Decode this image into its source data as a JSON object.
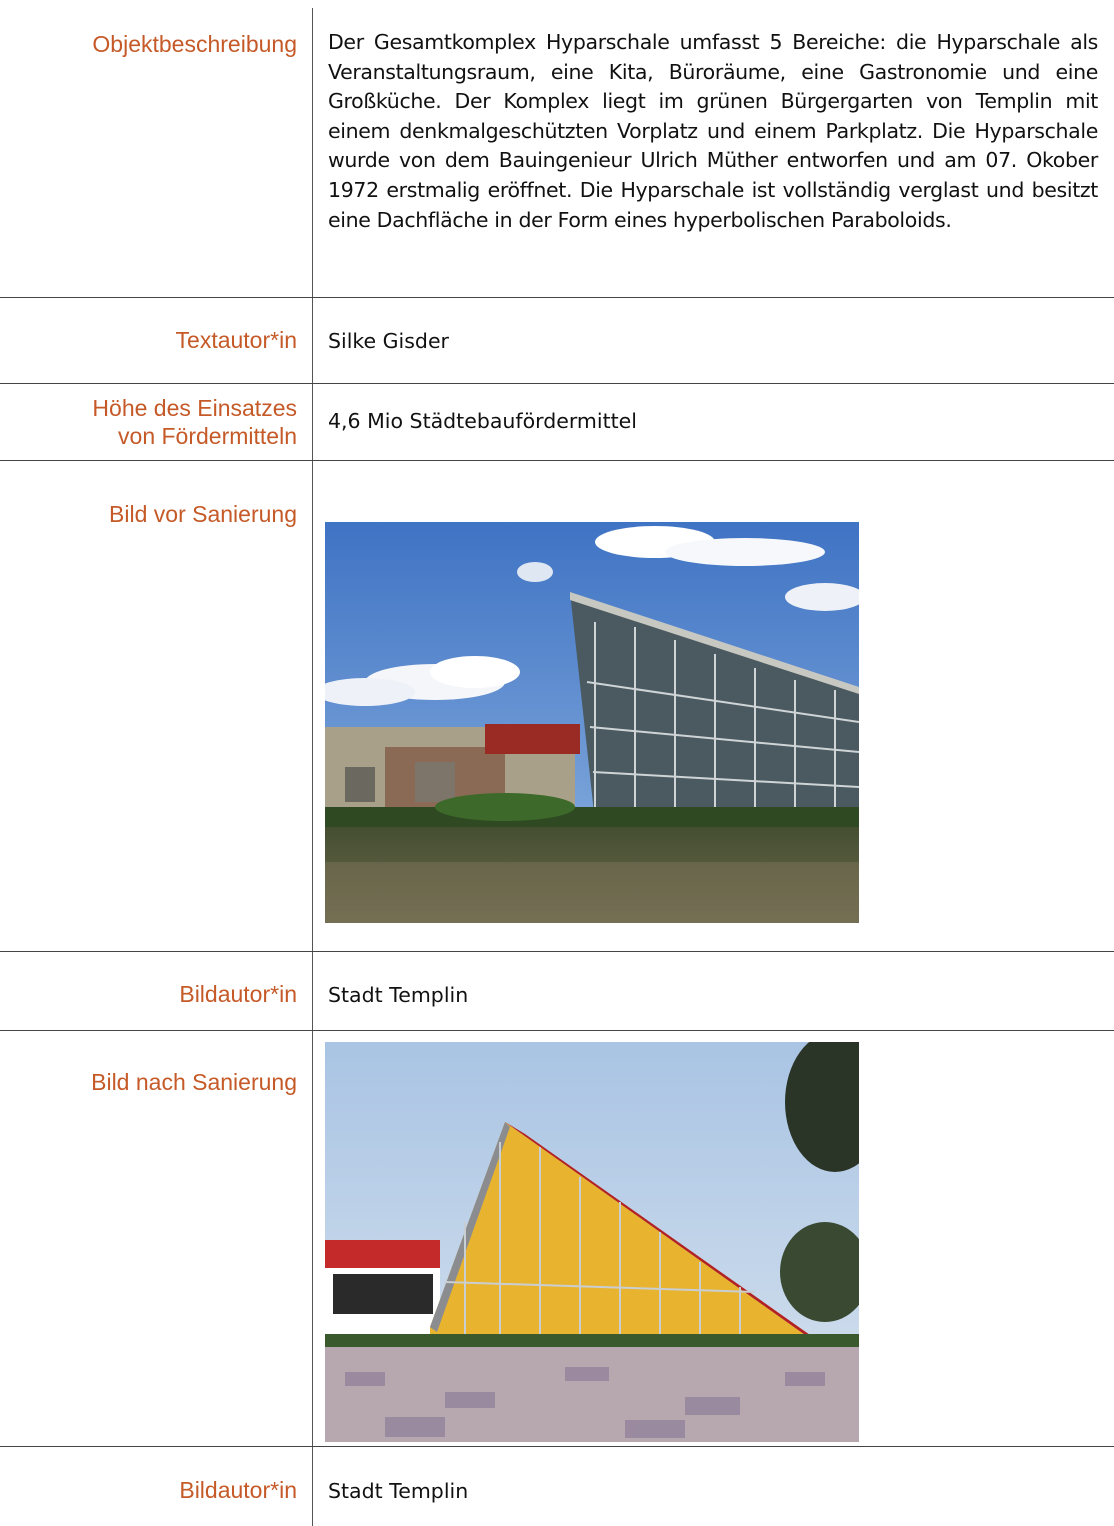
{
  "rows": {
    "description": {
      "label": "Objektbeschreibung",
      "text": "Der Gesamtkomplex Hyparschale umfasst 5 Bereiche: die Hyparschale als Veranstaltungsraum, eine Kita, Büroräume, eine Gastronomie und eine Großküche. Der Komplex liegt im grünen Bürgergarten von Templin mit einem denkmalgeschützten Vorplatz und einem Parkplatz. Die Hyparschale wurde von dem Bauingenieur Ulrich Müther entworfen und am 07. Okober 1972 erstmalig eröffnet. Die Hyparschale ist vollständig verglast und besitzt eine Dachfläche in der Form eines hyperbolischen Paraboloids."
    },
    "text_author": {
      "label": "Textautor*in",
      "value": "Silke Gisder"
    },
    "funding": {
      "label_line1": "Höhe des Einsatzes",
      "label_line2": "von Fördermitteln",
      "value": "4,6 Mio Städtebaufördermittel"
    },
    "image_before": {
      "label": "Bild vor Sanierung"
    },
    "image_author_1": {
      "label": "Bildautor*in",
      "value": "Stadt Templin"
    },
    "image_after": {
      "label": "Bild nach Sanierung"
    },
    "image_author_2": {
      "label": "Bildautor*in",
      "value": "Stadt Templin"
    }
  },
  "colors": {
    "label": "#c55a28",
    "text": "#111111",
    "rule": "#444444"
  }
}
